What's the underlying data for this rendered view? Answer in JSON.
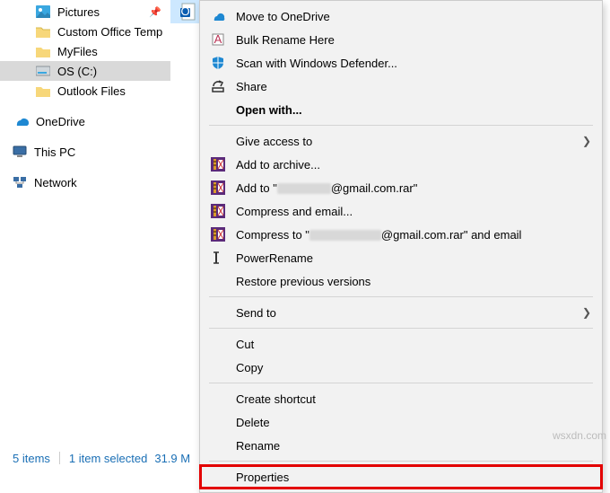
{
  "nav": {
    "items": [
      {
        "label": "Pictures",
        "icon": "pictures",
        "pinned": true
      },
      {
        "label": "Custom Office Temp",
        "icon": "folder"
      },
      {
        "label": "MyFiles",
        "icon": "folder"
      },
      {
        "label": "OS (C:)",
        "icon": "drive",
        "selected": true
      },
      {
        "label": "Outlook Files",
        "icon": "folder"
      }
    ],
    "roots": [
      {
        "label": "OneDrive",
        "icon": "onedrive"
      },
      {
        "label": "This PC",
        "icon": "thispc"
      },
      {
        "label": "Network",
        "icon": "network"
      }
    ]
  },
  "status": {
    "count": "5 items",
    "selected": "1 item selected",
    "size": "31.9 M"
  },
  "watermark": "wsxdn.com",
  "context_menu": {
    "redacted_a_width": 60,
    "redacted_b_width": 80,
    "email_tail_a": "@gmail.com.rar\"",
    "email_tail_b": "@gmail.com.rar\" and email",
    "items": [
      {
        "label": "Move to OneDrive",
        "icon": "onedrive-sm"
      },
      {
        "label": "Bulk Rename Here",
        "icon": "rename"
      },
      {
        "label": "Scan with Windows Defender...",
        "icon": "defender"
      },
      {
        "label": "Share",
        "icon": "share"
      },
      {
        "label": "Open with...",
        "bold": true
      },
      {
        "sep": true
      },
      {
        "label": "Give access to",
        "arrow": true
      },
      {
        "label": "Add to archive...",
        "icon": "rar"
      },
      {
        "label_prefix": "Add to \"",
        "redact": "a",
        "label_suffix_key": "email_tail_a",
        "icon": "rar"
      },
      {
        "label": "Compress and email...",
        "icon": "rar"
      },
      {
        "label_prefix": "Compress to \"",
        "redact": "b",
        "label_suffix_key": "email_tail_b",
        "icon": "rar"
      },
      {
        "label": "PowerRename",
        "icon": "powerrename"
      },
      {
        "label": "Restore previous versions"
      },
      {
        "sep": true
      },
      {
        "label": "Send to",
        "arrow": true
      },
      {
        "sep": true
      },
      {
        "label": "Cut"
      },
      {
        "label": "Copy"
      },
      {
        "sep": true
      },
      {
        "label": "Create shortcut"
      },
      {
        "label": "Delete"
      },
      {
        "label": "Rename"
      },
      {
        "sep": true
      },
      {
        "label": "Properties",
        "highlight": true
      }
    ]
  }
}
